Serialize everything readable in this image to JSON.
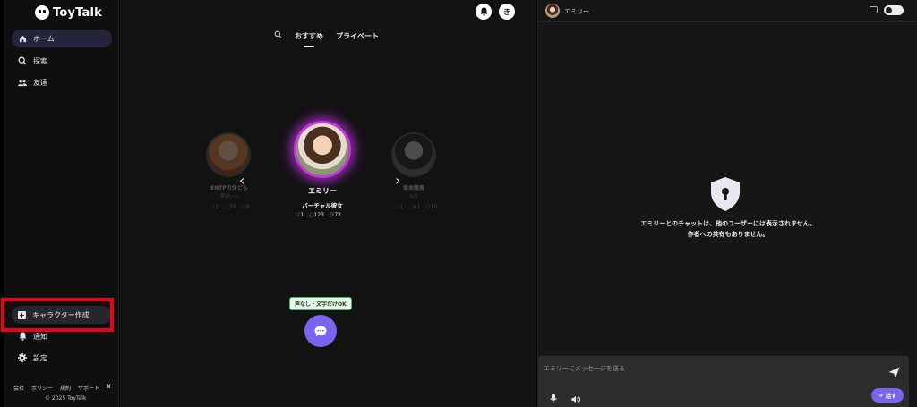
{
  "app": {
    "name": "ToyTalk"
  },
  "sidebar": {
    "items": [
      {
        "label": "ホーム",
        "icon": "home-icon"
      },
      {
        "label": "探索",
        "icon": "explore-icon"
      },
      {
        "label": "友達",
        "icon": "friends-icon"
      }
    ],
    "create_label": "キャラクター作成",
    "notify_label": "通知",
    "settings_label": "設定",
    "footer_links": [
      "会社",
      "ポリシー",
      "規約",
      "サポート",
      "X"
    ],
    "copyright": "© 2025 ToyTalk"
  },
  "header": {
    "profile_initial": "き"
  },
  "tabs": [
    {
      "label": "おすすめ",
      "active": true
    },
    {
      "label": "プライベート",
      "active": false
    }
  ],
  "carousel": {
    "center": {
      "name": "エミリー",
      "subtitle": "バーチャル彼女",
      "likes": "1",
      "chats": "123",
      "users": "72"
    },
    "left": {
      "name": "ENTPの女ども",
      "subtitle": "夢追い人",
      "likes": "1",
      "chats": "39",
      "users": "9"
    },
    "right": {
      "name": "坂本龍馬",
      "subtitle": "先生",
      "likes": "1",
      "chats": "41",
      "users": "10"
    }
  },
  "mode_badge": "声なし・文字だけOK",
  "chat": {
    "name": "エミリー",
    "privacy_line1": "エミリーとのチャットは、他のユーザーには表示されません。",
    "privacy_line2": "作者への共有もありません。",
    "placeholder": "エミリーにメッセージを送る",
    "speak_label": "話す"
  },
  "colors": {
    "accent": "#7a63ee",
    "highlight": "#e3051b",
    "pink_glow": "#c33ad8"
  }
}
